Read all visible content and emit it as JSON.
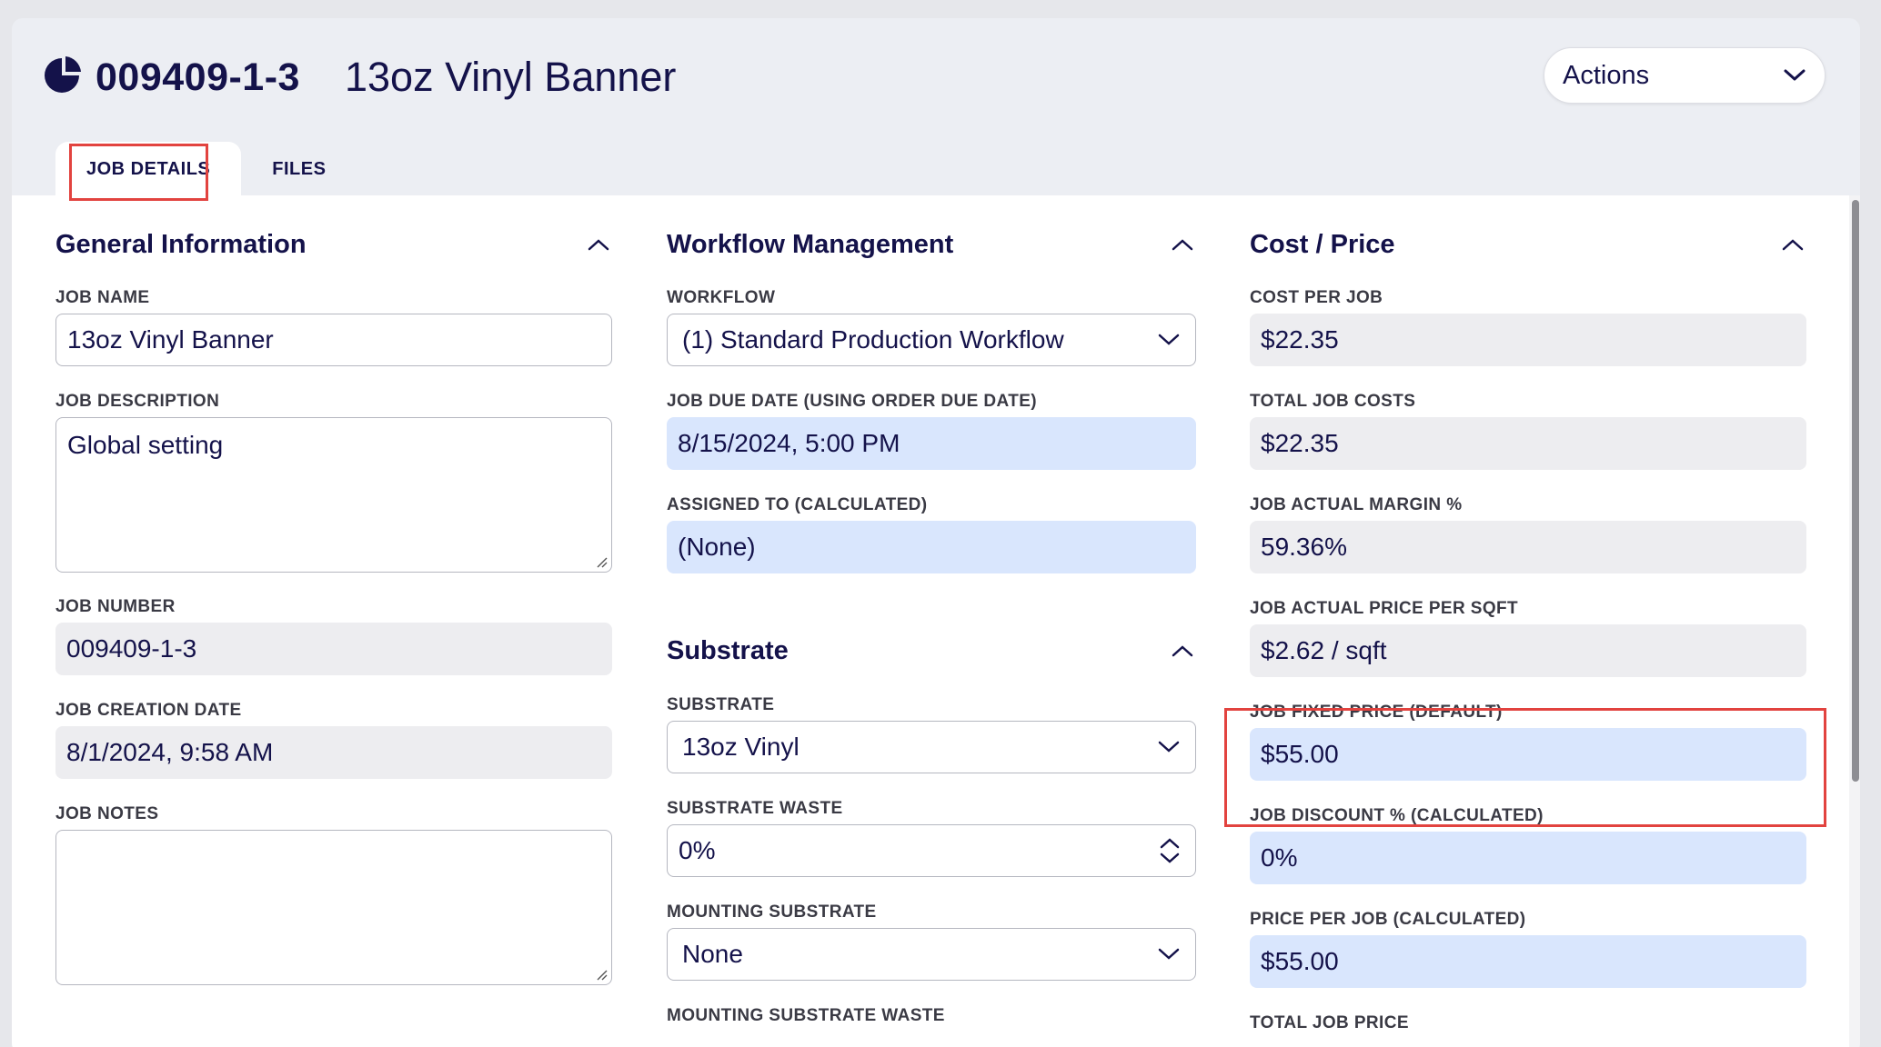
{
  "header": {
    "job_number": "009409-1-3",
    "job_title": "13oz Vinyl Banner",
    "actions_label": "Actions",
    "icon": "pie-chart-icon"
  },
  "tabs": [
    {
      "label": "JOB DETAILS",
      "active": true
    },
    {
      "label": "FILES",
      "active": false
    }
  ],
  "general": {
    "title": "General Information",
    "job_name_label": "JOB NAME",
    "job_name_value": "13oz Vinyl Banner",
    "job_description_label": "JOB DESCRIPTION",
    "job_description_value": "Global setting",
    "job_number_label": "JOB NUMBER",
    "job_number_value": "009409-1-3",
    "job_creation_date_label": "JOB CREATION DATE",
    "job_creation_date_value": "8/1/2024, 9:58 AM",
    "job_notes_label": "JOB NOTES",
    "job_notes_value": ""
  },
  "workflow": {
    "title": "Workflow Management",
    "workflow_label": "WORKFLOW",
    "workflow_value": "(1) Standard Production Workflow",
    "due_date_label": "JOB DUE DATE (USING ORDER DUE DATE)",
    "due_date_value": "8/15/2024, 5:00 PM",
    "assigned_label": "ASSIGNED TO (CALCULATED)",
    "assigned_value": "(None)"
  },
  "substrate": {
    "title": "Substrate",
    "substrate_label": "SUBSTRATE",
    "substrate_value": "13oz Vinyl",
    "waste_label": "SUBSTRATE WASTE",
    "waste_value": "0%",
    "mounting_label": "MOUNTING SUBSTRATE",
    "mounting_value": "None",
    "mounting_waste_label": "MOUNTING SUBSTRATE WASTE"
  },
  "cost": {
    "title": "Cost / Price",
    "cost_per_job_label": "COST PER JOB",
    "cost_per_job_value": "$22.35",
    "total_costs_label": "TOTAL JOB COSTS",
    "total_costs_value": "$22.35",
    "margin_label": "JOB ACTUAL MARGIN %",
    "margin_value": "59.36%",
    "price_sqft_label": "JOB ACTUAL PRICE PER SQFT",
    "price_sqft_value": "$2.62 / sqft",
    "fixed_price_label": "JOB FIXED PRICE (DEFAULT)",
    "fixed_price_value": "$55.00",
    "discount_label": "JOB DISCOUNT % (CALCULATED)",
    "discount_value": "0%",
    "price_per_job_label": "PRICE PER JOB (CALCULATED)",
    "price_per_job_value": "$55.00",
    "total_price_label": "TOTAL JOB PRICE"
  },
  "colors": {
    "highlight": "#e2433f",
    "navy": "#14124a",
    "field_blue": "#d9e6fd",
    "field_gray": "#ededf0"
  }
}
